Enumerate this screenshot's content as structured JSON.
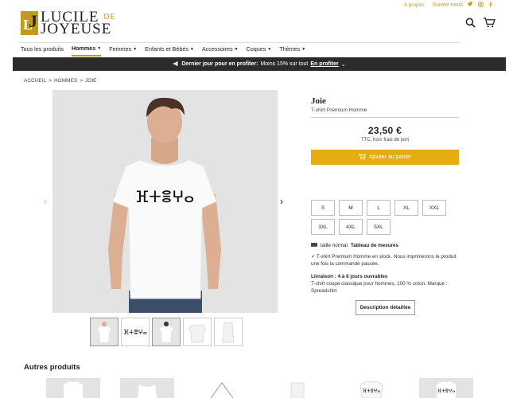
{
  "topbar": {
    "about": "A propos",
    "follow": "Suivez-nous"
  },
  "brand": {
    "line1": "LUCILE",
    "line2": "JOYEUSE",
    "de": "DE"
  },
  "nav": {
    "items": [
      {
        "label": "Tous les produits",
        "chev": ""
      },
      {
        "label": "Hommes",
        "chev": "⌵"
      },
      {
        "label": "Femmes",
        "chev": "⌵"
      },
      {
        "label": "Enfants et Bébés",
        "chev": "⌵"
      },
      {
        "label": "Accessoires",
        "chev": "⌵"
      },
      {
        "label": "Coques",
        "chev": "⌵"
      },
      {
        "label": "Thèmes",
        "chev": "⌵"
      }
    ]
  },
  "promo": {
    "bold": "Dernier jour pour en profiter:",
    "text": "Moins 15% sur tout",
    "link": "En profiter"
  },
  "breadcrumb": {
    "a": "ACCUEIL",
    "b": "HOMMES",
    "c": "JOIE",
    "sep": ">"
  },
  "product": {
    "title": "Joie",
    "subtitle": "T-shirt Premium Homme",
    "price": "23,50 €",
    "tax": "TTC, hors frais de port",
    "add_to_cart": "Ajouter au panier",
    "sizes": [
      "S",
      "M",
      "L",
      "XL",
      "XXL",
      "3XL",
      "4XL",
      "5XL"
    ],
    "fit_label": "taille normal",
    "size_table": "Tableau de mesures",
    "stock": "✓ T-shirt Premium Homme en stock. Nous imprimerons le produit une fois la commande passée.",
    "delivery_title": "Livraison : 4 à 6 jours ouvrables",
    "delivery_text": "T-shirt coupe classique pour hommes, 100 % coton. Marque : Spreadshirt",
    "detail_button": "Description détaillée",
    "print_text": "ⴼⵜⴻⵖⴰ"
  },
  "other": {
    "title": "Autres produits"
  },
  "colors": {
    "accent": "#e4ad12",
    "gold": "#c59a1a",
    "promo_bg": "#2b2b2b"
  }
}
